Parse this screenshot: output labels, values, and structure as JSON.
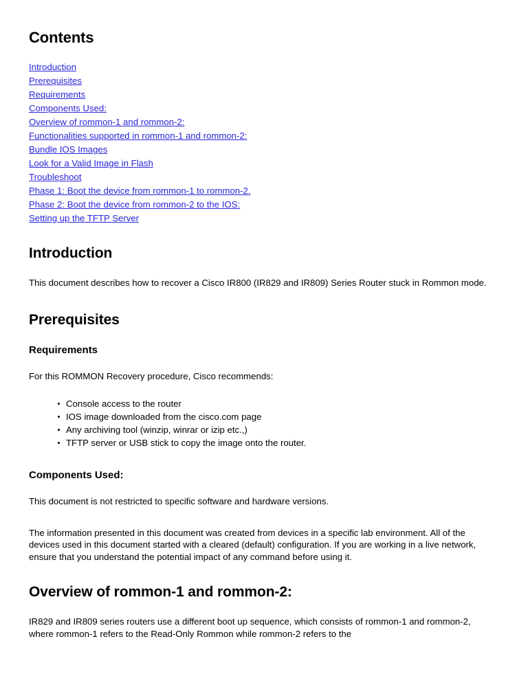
{
  "document": {
    "contents_heading": "Contents",
    "toc": [
      {
        "label": "Introduction"
      },
      {
        "label": "Prerequisites"
      },
      {
        "label": "Requirements"
      },
      {
        "label": "Components Used:"
      },
      {
        "label": "Overview of rommon-1 and rommon-2:"
      },
      {
        "label": "Functionalities supported in rommon-1 and rommon-2:"
      },
      {
        "label": "Bundle IOS Images"
      },
      {
        "label": "Look for a Valid Image in Flash"
      },
      {
        "label": "Troubleshoot"
      },
      {
        "label": "Phase 1: Boot the device from rommon-1 to rommon-2."
      },
      {
        "label": "Phase 2: Boot the device from rommon-2 to the IOS:"
      },
      {
        "label": "Setting up the TFTP Server"
      }
    ],
    "sections": {
      "introduction": {
        "heading": "Introduction",
        "paragraph": "This document describes how to recover a Cisco IR800 (IR829 and IR809) Series Router stuck in Rommon mode."
      },
      "prerequisites": {
        "heading": "Prerequisites"
      },
      "requirements": {
        "heading": "Requirements",
        "intro": "For this ROMMON Recovery procedure, Cisco recommends:",
        "bullets": [
          "Console access to the router",
          "IOS image downloaded from the cisco.com page",
          "Any archiving tool (winzip, winrar or izip etc.,)",
          "TFTP server or USB stick to copy the image onto the router."
        ]
      },
      "components_used": {
        "heading": "Components Used:",
        "paragraph_1": "This document is not restricted to specific software and hardware versions.",
        "paragraph_2": "The information presented in this document was created from devices in a specific lab environment. All of the devices used in this document started with a cleared (default) configuration. If you are working in a live network, ensure that you understand the potential impact of any command before using it."
      },
      "overview": {
        "heading": "Overview of rommon-1 and rommon-2:",
        "paragraph": "IR829 and IR809 series routers use a different boot up sequence, which consists of rommon-1 and rommon-2, where rommon-1 refers to the Read-Only Rommon while rommon-2 refers to the"
      }
    },
    "colors": {
      "link": "#2a26d8",
      "text": "#000000",
      "background": "#ffffff"
    }
  }
}
